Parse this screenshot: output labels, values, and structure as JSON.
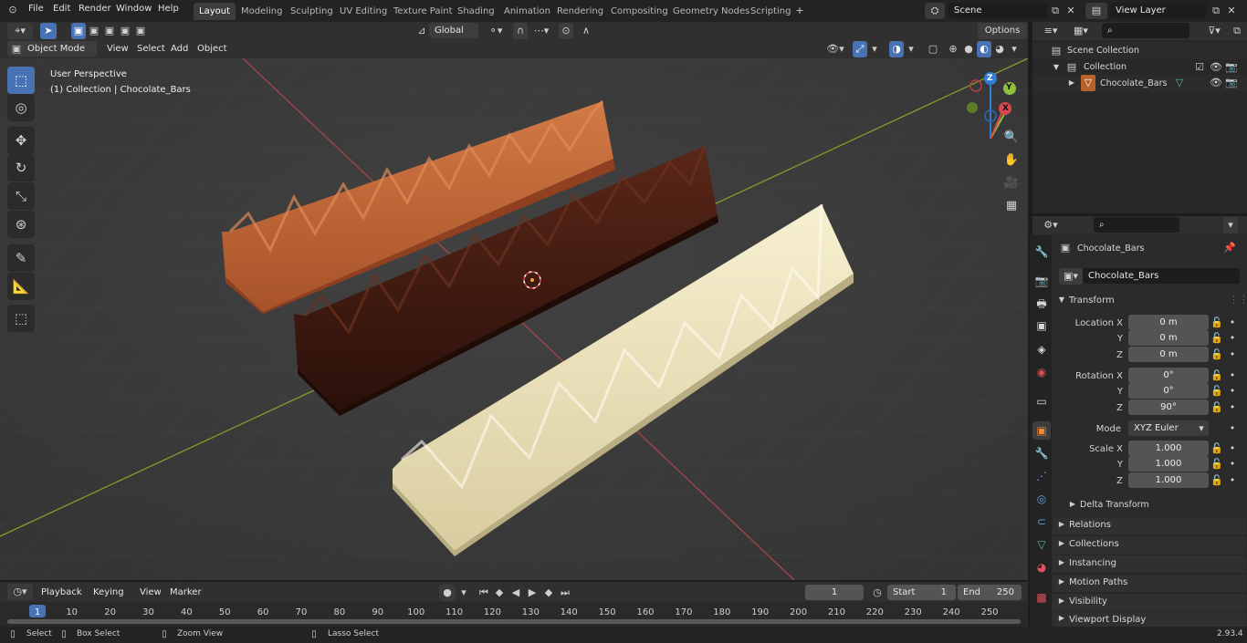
{
  "topbar": {
    "menus": [
      "File",
      "Edit",
      "Render",
      "Window",
      "Help"
    ],
    "tabs": [
      "Layout",
      "Modeling",
      "Sculpting",
      "UV Editing",
      "Texture Paint",
      "Shading",
      "Animation",
      "Rendering",
      "Compositing",
      "Geometry Nodes",
      "Scripting"
    ],
    "active_tab": "Layout",
    "scene": "Scene",
    "view_layer": "View Layer"
  },
  "viewport": {
    "mode": "Object Mode",
    "menus": [
      "View",
      "Select",
      "Add",
      "Object"
    ],
    "transform_orientation": "Global",
    "options": "Options",
    "perspective": "User Perspective",
    "collection_info": "(1) Collection | Chocolate_Bars",
    "gizmo": {
      "z": "Z",
      "y": "Y",
      "x": "X"
    }
  },
  "outliner": {
    "scene_collection": "Scene Collection",
    "collection": "Collection",
    "object": "Chocolate_Bars"
  },
  "properties": {
    "object_name": "Chocolate_Bars",
    "datablock": "Chocolate_Bars",
    "transform_label": "Transform",
    "location_x_label": "Location X",
    "location_x": "0 m",
    "location_y_label": "Y",
    "location_y": "0 m",
    "location_z_label": "Z",
    "location_z": "0 m",
    "rotation_x_label": "Rotation X",
    "rotation_x": "0°",
    "rotation_y_label": "Y",
    "rotation_y": "0°",
    "rotation_z_label": "Z",
    "rotation_z": "90°",
    "mode_label": "Mode",
    "mode": "XYZ Euler",
    "scale_x_label": "Scale X",
    "scale_x": "1.000",
    "scale_y_label": "Y",
    "scale_y": "1.000",
    "scale_z_label": "Z",
    "scale_z": "1.000",
    "delta": "Delta Transform",
    "panels": [
      "Relations",
      "Collections",
      "Instancing",
      "Motion Paths",
      "Visibility",
      "Viewport Display"
    ]
  },
  "timeline": {
    "menus": [
      "Playback",
      "Keying",
      "View",
      "Marker"
    ],
    "current_frame": "1",
    "start_label": "Start",
    "start": "1",
    "end_label": "End",
    "end": "250",
    "ticks": [
      "1",
      "10",
      "20",
      "30",
      "40",
      "50",
      "60",
      "70",
      "80",
      "90",
      "100",
      "110",
      "120",
      "130",
      "140",
      "150",
      "160",
      "170",
      "180",
      "190",
      "200",
      "210",
      "220",
      "230",
      "240",
      "250"
    ]
  },
  "statusbar": {
    "select": "Select",
    "box_select": "Box Select",
    "zoom_view": "Zoom View",
    "lasso_select": "Lasso Select",
    "version": "2.93.4"
  },
  "colors": {
    "accent": "#4772b3",
    "milk": "#c4693a",
    "dark": "#4a1f14",
    "white": "#ece3bd",
    "x_axis": "#d64750",
    "y_axis": "#6f9a1f"
  }
}
